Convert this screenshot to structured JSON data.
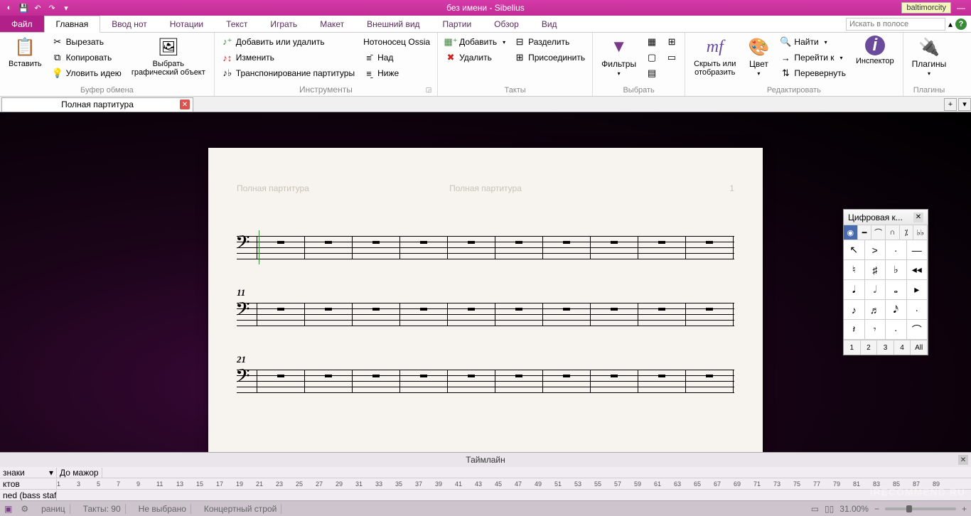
{
  "title": "без имени - Sibelius",
  "user": "baltimorcity",
  "tabs": {
    "file": "Файл",
    "items": [
      "Главная",
      "Ввод нот",
      "Нотации",
      "Текст",
      "Играть",
      "Макет",
      "Внешний вид",
      "Партии",
      "Обзор",
      "Вид"
    ],
    "active": 0
  },
  "search_placeholder": "Искать в полосе",
  "ribbon": {
    "clipboard": {
      "label": "Буфер обмена",
      "paste": "Вставить",
      "cut": "Вырезать",
      "copy": "Копировать",
      "capture": "Уловить идею",
      "select_graphic": "Выбрать\nграфический объект"
    },
    "instruments": {
      "label": "Инструменты",
      "add_remove": "Добавить или удалить",
      "change": "Изменить",
      "transpose": "Транспонирование партитуры",
      "ossia": "Нотоносец Ossia",
      "above": "Над",
      "below": "Ниже"
    },
    "bars": {
      "label": "Такты",
      "add": "Добавить",
      "delete": "Удалить",
      "split": "Разделить",
      "join": "Присоединить"
    },
    "select": {
      "label": "Выбрать",
      "filters": "Фильтры"
    },
    "edit": {
      "label": "Редактировать",
      "hide": "Скрыть или\nотобразить",
      "color": "Цвет",
      "find": "Найти",
      "goto": "Перейти к",
      "flip": "Перевернуть",
      "inspector": "Инспектор"
    },
    "plugins": {
      "label": "Плагины",
      "plugins": "Плагины"
    }
  },
  "doctab": "Полная партитура",
  "page": {
    "left": "Полная партитура",
    "center": "Полная партитура",
    "number": "1",
    "bar_labels": [
      "",
      "11",
      "21"
    ]
  },
  "keypad": {
    "title": "Цифровая к...",
    "tabs": [
      "◉",
      "━",
      "⌒",
      "∩",
      "⁒",
      "♭♭"
    ],
    "grid": [
      "↖",
      ">",
      "·",
      "—",
      "♮",
      "♯",
      "♭",
      "◂◂",
      "𝅘𝅥",
      "𝅗𝅥",
      "𝅝",
      "▸",
      "♪",
      "♬",
      "𝅘𝅥𝅯",
      "·",
      "𝄽",
      "𝄾",
      "·",
      "⌒"
    ],
    "voices": [
      "1",
      "2",
      "3",
      "4",
      "All"
    ]
  },
  "timeline": {
    "title": "Таймлайн",
    "row1_label": "знаки",
    "row1_value": "До мажор",
    "row2_label": "ктов",
    "row3_label": "ned (bass staff...",
    "bars": [
      1,
      3,
      5,
      7,
      9,
      11,
      13,
      15,
      17,
      19,
      21,
      23,
      25,
      27,
      29,
      31,
      33,
      35,
      37,
      39,
      41,
      43,
      45,
      47,
      49,
      51,
      53,
      55,
      57,
      59,
      61,
      63,
      65,
      67,
      69,
      71,
      73,
      75,
      77,
      79,
      81,
      83,
      85,
      87,
      89
    ]
  },
  "status": {
    "pages": "раниц",
    "bars": "Такты: 90",
    "selection": "Не выбрано",
    "concert": "Концертный строй",
    "zoom": "31.00%"
  },
  "watermark": "IRECOMMEND.RU"
}
